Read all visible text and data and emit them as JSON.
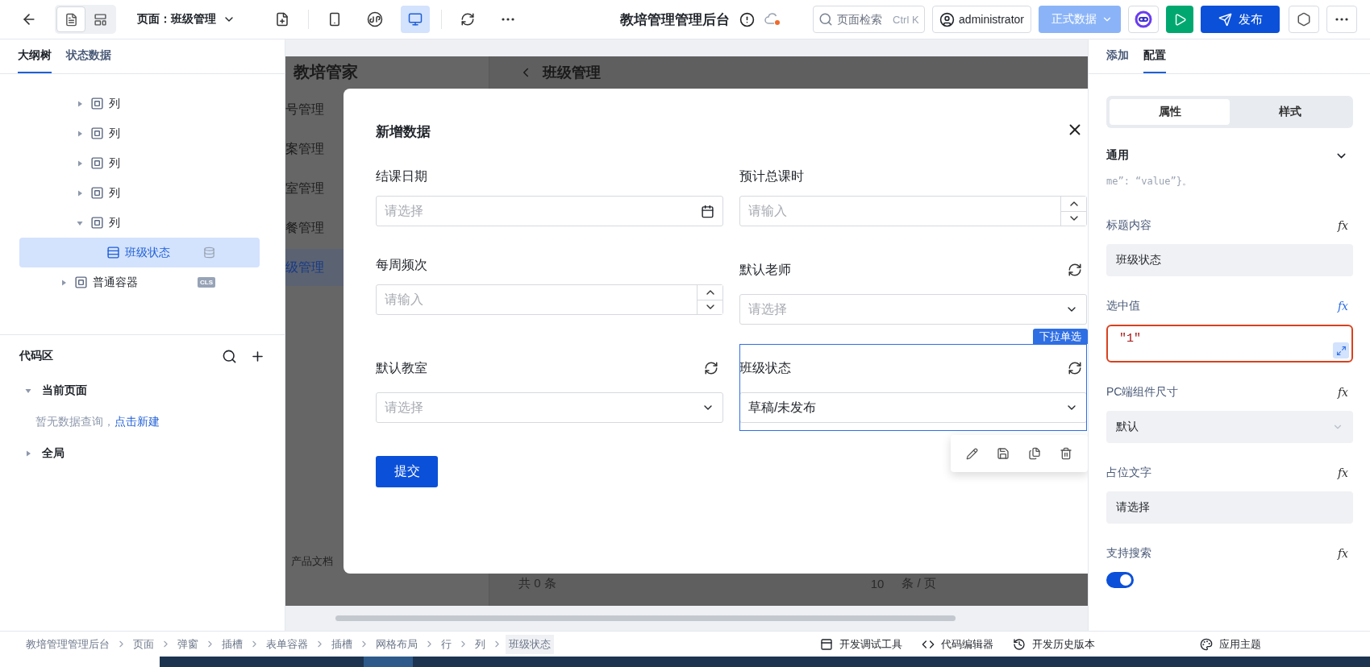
{
  "topbar": {
    "view_modes": [
      {
        "kind": "page",
        "selected": true
      },
      {
        "kind": "layout",
        "selected": false
      }
    ],
    "page_selector": "页面：班级管理",
    "devices": [
      {
        "kind": "mobile",
        "selected": false
      },
      {
        "kind": "miniapp",
        "selected": false
      },
      {
        "kind": "desktop",
        "selected": true
      }
    ],
    "app_title": "教培管理管理后台",
    "search": {
      "placeholder": "页面检索",
      "shortcut": "Ctrl K"
    },
    "user": "administrator",
    "data_env": "正式数据",
    "publish": "发布"
  },
  "left_panel": {
    "tabs": [
      {
        "label": "大纲树",
        "selected": true
      },
      {
        "label": "状态数据",
        "selected": false
      }
    ],
    "outline": [
      {
        "children": [
          {
            "label": "列",
            "kind": "container",
            "expanded": false,
            "selected": false
          },
          {
            "label": "列",
            "kind": "container",
            "expanded": false,
            "selected": false
          },
          {
            "label": "列",
            "kind": "container",
            "expanded": false,
            "selected": false
          },
          {
            "label": "列",
            "kind": "container",
            "expanded": false,
            "selected": false
          },
          {
            "label": "列",
            "kind": "container",
            "expanded": true,
            "selected": false,
            "children": [
              {
                "label": "班级状态",
                "kind": "field",
                "selected": true,
                "bound": true
              }
            ]
          }
        ]
      },
      {
        "label": "普通容器",
        "kind": "container",
        "expanded": false,
        "selected": false,
        "badge": "CLS"
      }
    ],
    "code_area": {
      "title": "代码区",
      "sections": [
        {
          "label": "当前页面",
          "expanded": true,
          "empty_text": "暂无数据查询，",
          "link": "点击新建"
        },
        {
          "label": "全局",
          "expanded": false
        }
      ]
    }
  },
  "canvas": {
    "background_app": {
      "brand": "教培管家",
      "menu": [
        {
          "label": "号管理",
          "selected": false
        },
        {
          "label": "案管理",
          "selected": false
        },
        {
          "label": "室管理",
          "selected": false
        },
        {
          "label": "餐管理",
          "selected": false
        },
        {
          "label": "级管理",
          "selected": true
        }
      ],
      "docs": "产品文档",
      "page_title": "班级管理",
      "total": "共 0 条",
      "page_size": "10",
      "per_page": "条 / 页"
    },
    "modal": {
      "title": "新增数据",
      "fields": [
        {
          "label": "结课日期",
          "kind": "date",
          "placeholder": "请选择",
          "refresh": false,
          "selected": false
        },
        {
          "label": "预计总课时",
          "kind": "number",
          "placeholder": "请输入",
          "refresh": false,
          "selected": false
        },
        {
          "label": "每周频次",
          "kind": "number",
          "placeholder": "请输入",
          "refresh": false,
          "selected": false
        },
        {
          "label": "默认老师",
          "kind": "select",
          "placeholder": "请选择",
          "refresh": true,
          "selected": false
        },
        {
          "label": "默认教室",
          "kind": "select",
          "placeholder": "请选择",
          "refresh": true,
          "selected": false
        },
        {
          "label": "班级状态",
          "kind": "select",
          "value": "草稿/未发布",
          "refresh": true,
          "selected": true
        }
      ],
      "component_tag": "下拉单选",
      "submit": "提交"
    }
  },
  "right_panel": {
    "tabs": [
      {
        "label": "添加",
        "selected": false
      },
      {
        "label": "配置",
        "selected": true
      }
    ],
    "segments": [
      {
        "label": "属性",
        "selected": true
      },
      {
        "label": "样式",
        "selected": false
      }
    ],
    "section": {
      "title": "通用",
      "expanded": true
    },
    "code_hint": "me”: “value”}。",
    "fields": [
      {
        "label": "标题内容",
        "kind": "text",
        "value": "班级状态",
        "fx": "fx",
        "fx_active": false
      },
      {
        "label": "选中值",
        "kind": "code",
        "value": "\"1\"",
        "fx": "fx",
        "fx_active": true,
        "invalid": true
      },
      {
        "label": "PC端组件尺寸",
        "kind": "select",
        "value": "默认",
        "fx": "fx",
        "fx_active": false
      },
      {
        "label": "占位文字",
        "kind": "text",
        "value": "请选择",
        "fx": "fx",
        "fx_active": false
      },
      {
        "label": "支持搜索",
        "kind": "switch",
        "on": true,
        "fx": "fx",
        "fx_active": false
      }
    ]
  },
  "footer": {
    "breadcrumbs": [
      {
        "label": "教培管理管理后台",
        "selected": false
      },
      {
        "label": "页面",
        "selected": false
      },
      {
        "label": "弹窗",
        "selected": false
      },
      {
        "label": "插槽",
        "selected": false
      },
      {
        "label": "表单容器",
        "selected": false
      },
      {
        "label": "插槽",
        "selected": false
      },
      {
        "label": "网格布局",
        "selected": false
      },
      {
        "label": "行",
        "selected": false
      },
      {
        "label": "列",
        "selected": false
      },
      {
        "label": "班级状态",
        "selected": true
      }
    ],
    "tools": [
      {
        "kind": "debug",
        "label": "开发调试工具"
      },
      {
        "kind": "code",
        "label": "代码编辑器"
      },
      {
        "kind": "history",
        "label": "开发历史版本"
      },
      {
        "kind": "theme",
        "label": "应用主题"
      }
    ]
  }
}
